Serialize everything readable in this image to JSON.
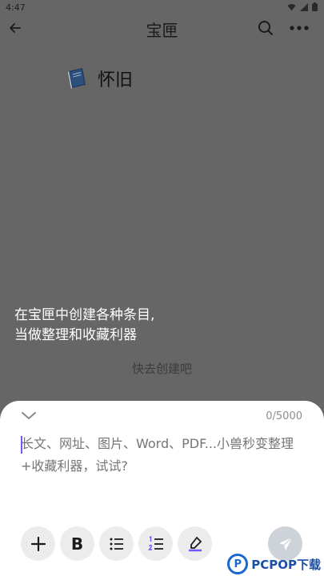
{
  "status_bar": {
    "time": "4:47",
    "icons": [
      "wifi-icon",
      "signal-icon",
      "battery-icon"
    ]
  },
  "app_bar": {
    "title": "宝匣",
    "icons": [
      "back-arrow-icon",
      "search-icon",
      "more-icon"
    ]
  },
  "category": {
    "icon": "book-icon",
    "label": "怀旧"
  },
  "empty_state": {
    "line1": "在宝匣中创建各种条目,",
    "line2": "当做整理和收藏利器",
    "hint": "快去创建吧"
  },
  "composer": {
    "counter": "0/5000",
    "placeholder": "长文、网址、图片、Word、PDF...小兽秒变整理+收藏利器，试试?",
    "value": "",
    "tools": [
      {
        "name": "add",
        "glyph": "+"
      },
      {
        "name": "bold",
        "glyph": "B"
      },
      {
        "name": "bullet-list",
        "glyph": ""
      },
      {
        "name": "numbered-list",
        "glyph": ""
      },
      {
        "name": "highlight",
        "glyph": ""
      }
    ],
    "send_icon": "send-icon"
  },
  "watermark": {
    "text": "PCPOP下载",
    "logo_letter": "P"
  },
  "colors": {
    "overlay": "#666666",
    "sheet": "#ffffff",
    "accent_cursor": "#6b5bff",
    "send_disabled": "#cdd3d8",
    "watermark_blue": "#1c4fa5"
  }
}
